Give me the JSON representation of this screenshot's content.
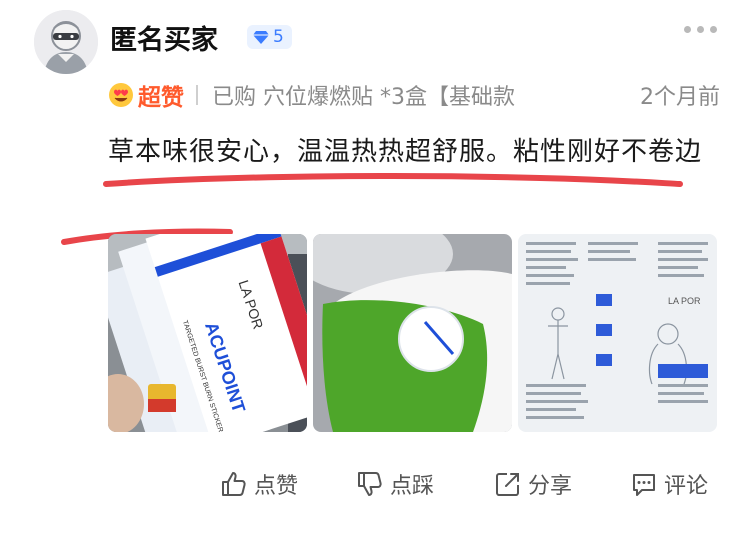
{
  "user": {
    "name": "匿名买家",
    "level": "5"
  },
  "review": {
    "praise_label": "超赞",
    "purchase_info": "已购 穴位爆燃贴 *3盒【基础款",
    "time": "2个月前",
    "text": "草本味很安心，温温热热超舒服。粘性刚好不卷边"
  },
  "photos": [
    {
      "brand": "LA POR",
      "product": "ACUPOINT",
      "subtitle": "TARGETED BURST BURN STICKER"
    },
    {
      "label": ""
    },
    {
      "brand": "LA POR"
    }
  ],
  "actions": {
    "like": "点赞",
    "dislike": "点踩",
    "share": "分享",
    "comment": "评论"
  },
  "colors": {
    "accent_blue": "#3b7cff",
    "praise_orange": "#ff5a2c",
    "highlight_red": "#e8454a"
  }
}
